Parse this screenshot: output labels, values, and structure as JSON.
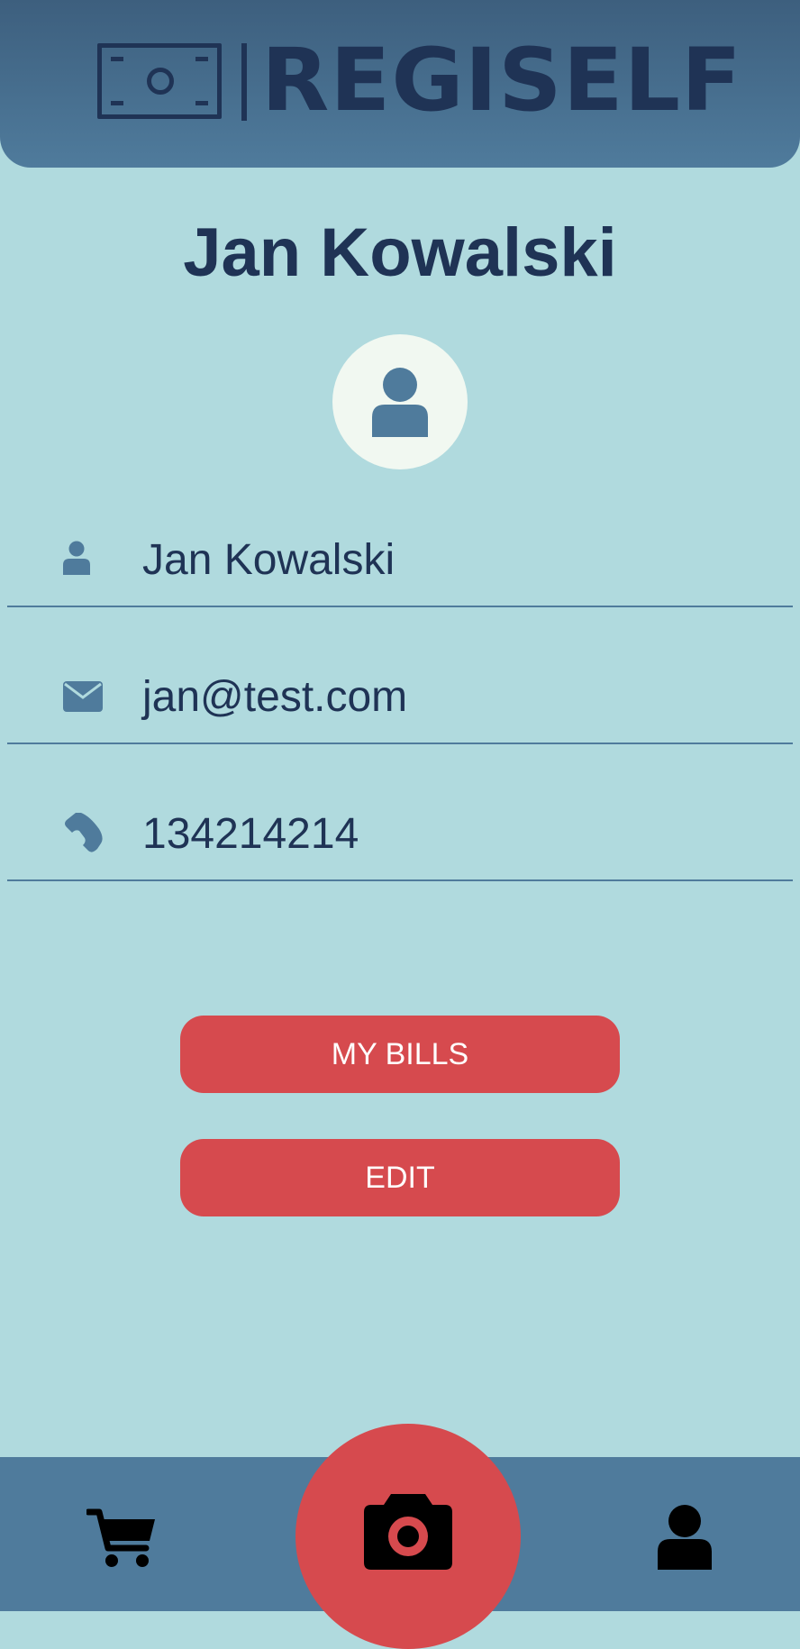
{
  "app": {
    "name": "REGISELF",
    "colors": {
      "background": "#b0dade",
      "header": "#4f7b9c",
      "accent": "#d64a4e",
      "text": "#1f3355",
      "avatar_bg": "#f1f8f1"
    }
  },
  "profile": {
    "title": "Jan Kowalski",
    "fields": [
      {
        "icon": "user-icon",
        "value": "Jan Kowalski"
      },
      {
        "icon": "envelope-icon",
        "value": "jan@test.com"
      },
      {
        "icon": "phone-icon",
        "value": "134214214"
      }
    ]
  },
  "actions": {
    "my_bills_label": "MY BILLS",
    "edit_label": "EDIT"
  },
  "tabbar": {
    "items": [
      {
        "icon": "cart-icon"
      },
      {
        "icon": "camera-icon"
      },
      {
        "icon": "user-icon"
      }
    ]
  }
}
